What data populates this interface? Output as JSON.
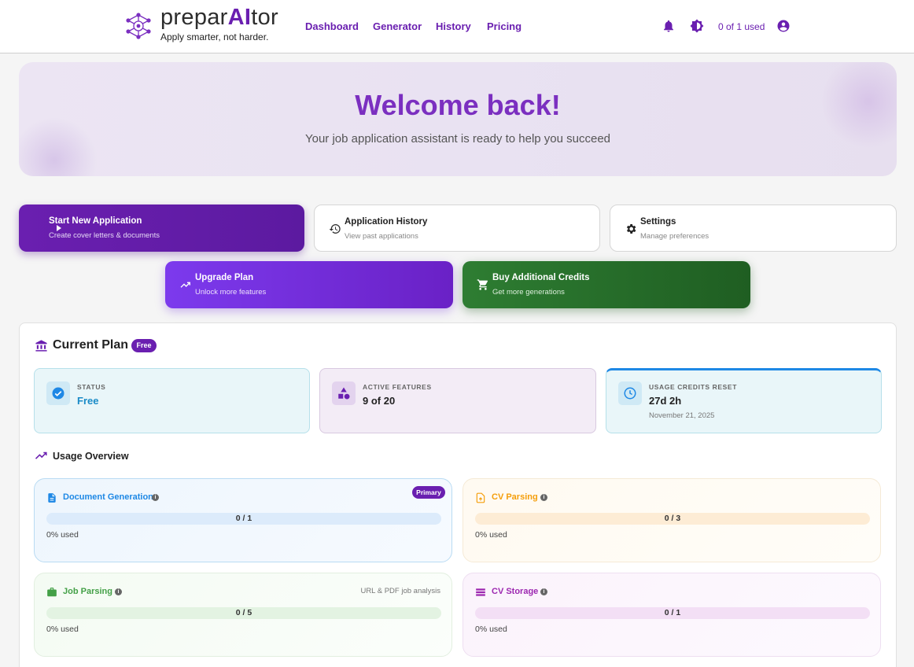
{
  "brand": {
    "name_pre": "prepar",
    "name_ai": "AI",
    "name_post": "tor",
    "tagline": "Apply smarter, not harder."
  },
  "nav": [
    {
      "label": "Dashboard"
    },
    {
      "label": "Generator"
    },
    {
      "label": "History"
    },
    {
      "label": "Pricing"
    }
  ],
  "header": {
    "usage": "0 of 1 used",
    "icons": [
      "bell-icon",
      "theme-toggle-icon",
      "account-icon"
    ]
  },
  "hero": {
    "title": "Welcome back!",
    "subtitle": "Your job application assistant is ready to help you succeed"
  },
  "actions": [
    {
      "title": "Start New Application",
      "subtitle": "Create cover letters & documents",
      "icon": "play-icon"
    },
    {
      "title": "Application History",
      "subtitle": "View past applications",
      "icon": "history-icon"
    },
    {
      "title": "Settings",
      "subtitle": "Manage preferences",
      "icon": "gear-icon"
    },
    {
      "title": "Upgrade Plan",
      "subtitle": "Unlock more features",
      "icon": "trending-up-icon"
    },
    {
      "title": "Buy Additional Credits",
      "subtitle": "Get more generations",
      "icon": "cart-icon"
    }
  ],
  "plan": {
    "title": "Current Plan",
    "badge": "Free",
    "stats": [
      {
        "label": "STATUS",
        "value": "Free",
        "icon": "check-circle-icon"
      },
      {
        "label": "ACTIVE FEATURES",
        "value": "9 of 20",
        "icon": "shapes-icon"
      },
      {
        "label": "USAGE CREDITS RESET",
        "value": "27d 2h",
        "sub": "November 21, 2025",
        "icon": "clock-icon"
      }
    ]
  },
  "usage": {
    "title": "Usage Overview",
    "items": [
      {
        "name": "Document Generation",
        "used": 0,
        "limit": 1,
        "bar": "0 / 1",
        "percent_label": "0% used",
        "badge": "Primary",
        "color": "#1e88e5",
        "icon": "document-icon"
      },
      {
        "name": "CV Parsing",
        "used": 0,
        "limit": 3,
        "bar": "0 / 3",
        "percent_label": "0% used",
        "color": "#f59e0b",
        "icon": "file-upload-icon"
      },
      {
        "name": "Job Parsing",
        "used": 0,
        "limit": 5,
        "bar": "0 / 5",
        "percent_label": "0% used",
        "note": "URL & PDF job analysis",
        "color": "#43a047",
        "icon": "briefcase-icon"
      },
      {
        "name": "CV Storage",
        "used": 0,
        "limit": 1,
        "bar": "0 / 1",
        "percent_label": "0% used",
        "color": "#9c27b0",
        "icon": "storage-icon"
      }
    ]
  },
  "colors": {
    "brand": "#6a1fb0",
    "accent": "#7b2fc0",
    "green": "#2e7d32"
  }
}
